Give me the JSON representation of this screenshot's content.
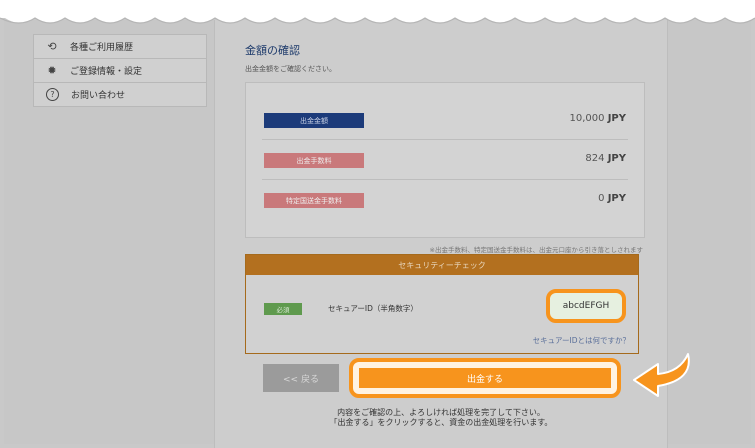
{
  "sidebar": {
    "items": [
      {
        "icon": "history-icon",
        "glyph": "⟲",
        "label": "各種ご利用履歴"
      },
      {
        "icon": "gear-icon",
        "glyph": "✹",
        "label": "ご登録情報・設定"
      },
      {
        "icon": "question-icon",
        "glyph": "?",
        "label": "お問い合わせ"
      }
    ]
  },
  "main": {
    "title": "金額の確認",
    "subtitle": "出金金額をご確認ください。",
    "rows": [
      {
        "label": "出金金額",
        "amount": "10,000",
        "currency": "JPY",
        "color": "#1c3b7a"
      },
      {
        "label": "出金手数料",
        "amount": "824",
        "currency": "JPY",
        "color": "#c9797b"
      },
      {
        "label": "特定国送金手数料",
        "amount": "0",
        "currency": "JPY",
        "color": "#c9797b"
      }
    ],
    "note": "※出金手数料、特定国送金手数料は、出金元口座から引き落としされます"
  },
  "security": {
    "header": "セキュリティーチェック",
    "required_badge": "必須",
    "field_label": "セキュアーID（半角数字）",
    "field_value": "abcdEFGH",
    "help_link": "セキュアーIDとは何ですか？"
  },
  "buttons": {
    "back": "<< 戻る",
    "submit": "出金する"
  },
  "footer": {
    "line1": "内容をご確認の上、よろしければ処理を完了して下さい。",
    "line2": "「出金する」をクリックすると、資金の出金処理を行います。"
  },
  "colors": {
    "accent": "#f7941d",
    "header_orange": "#b3701f",
    "navy": "#1c3b7a"
  }
}
